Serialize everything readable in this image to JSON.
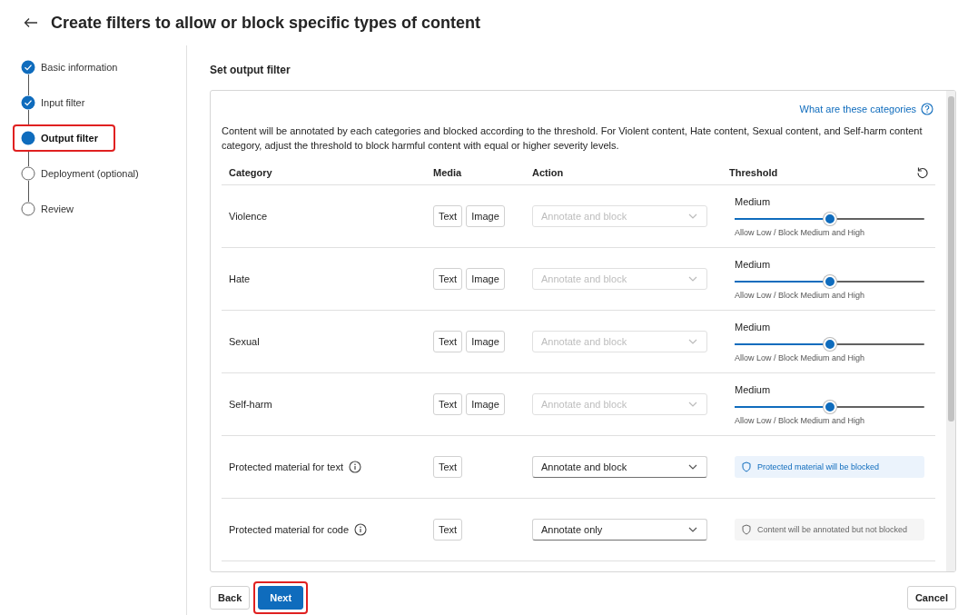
{
  "page": {
    "title": "Create filters to allow or block specific types of content"
  },
  "steps": [
    {
      "label": "Basic information",
      "completed": true,
      "current": false,
      "highlighted": false
    },
    {
      "label": "Input filter",
      "completed": true,
      "current": false,
      "highlighted": false
    },
    {
      "label": "Output filter",
      "completed": false,
      "current": true,
      "highlighted": true
    },
    {
      "label": "Deployment (optional)",
      "completed": false,
      "current": false,
      "highlighted": false
    },
    {
      "label": "Review",
      "completed": false,
      "current": false,
      "highlighted": false
    }
  ],
  "section": {
    "title": "Set output filter",
    "help_link": "What are these categories",
    "description": "Content will be annotated by each categories and blocked according to the threshold. For Violent content, Hate content, Sexual content, and Self-harm content category, adjust the threshold to block harmful content with equal or higher severity levels."
  },
  "table": {
    "columns": [
      "Category",
      "Media",
      "Action",
      "Threshold"
    ],
    "rows": [
      {
        "kind": "severity",
        "category": "Violence",
        "media": [
          "Text",
          "Image"
        ],
        "action": "Annotate and block",
        "action_disabled": true,
        "threshold": "Medium",
        "level": 0.5,
        "threshold_note": "Allow Low / Block Medium and High"
      },
      {
        "kind": "severity",
        "category": "Hate",
        "media": [
          "Text",
          "Image"
        ],
        "action": "Annotate and block",
        "action_disabled": true,
        "threshold": "Medium",
        "level": 0.5,
        "threshold_note": "Allow Low / Block Medium and High"
      },
      {
        "kind": "severity",
        "category": "Sexual",
        "media": [
          "Text",
          "Image"
        ],
        "action": "Annotate and block",
        "action_disabled": true,
        "threshold": "Medium",
        "level": 0.5,
        "threshold_note": "Allow Low / Block Medium and High"
      },
      {
        "kind": "severity",
        "category": "Self-harm",
        "media": [
          "Text",
          "Image"
        ],
        "action": "Annotate and block",
        "action_disabled": true,
        "threshold": "Medium",
        "level": 0.5,
        "threshold_note": "Allow Low / Block Medium and High"
      },
      {
        "kind": "protected",
        "category": "Protected material for text",
        "media": [
          "Text"
        ],
        "action": "Annotate and block",
        "action_disabled": false,
        "notice": "Protected material will be blocked",
        "blocked": true
      },
      {
        "kind": "protected",
        "category": "Protected material for code",
        "media": [
          "Text"
        ],
        "action": "Annotate only",
        "action_disabled": false,
        "notice": "Content will be annotated but not blocked",
        "blocked": false
      }
    ]
  },
  "footer": {
    "buttons": [
      {
        "label": "Back",
        "kind": "secondary",
        "highlighted": false
      },
      {
        "label": "Next",
        "kind": "primary",
        "highlighted": true
      }
    ],
    "cancel": "Cancel"
  }
}
